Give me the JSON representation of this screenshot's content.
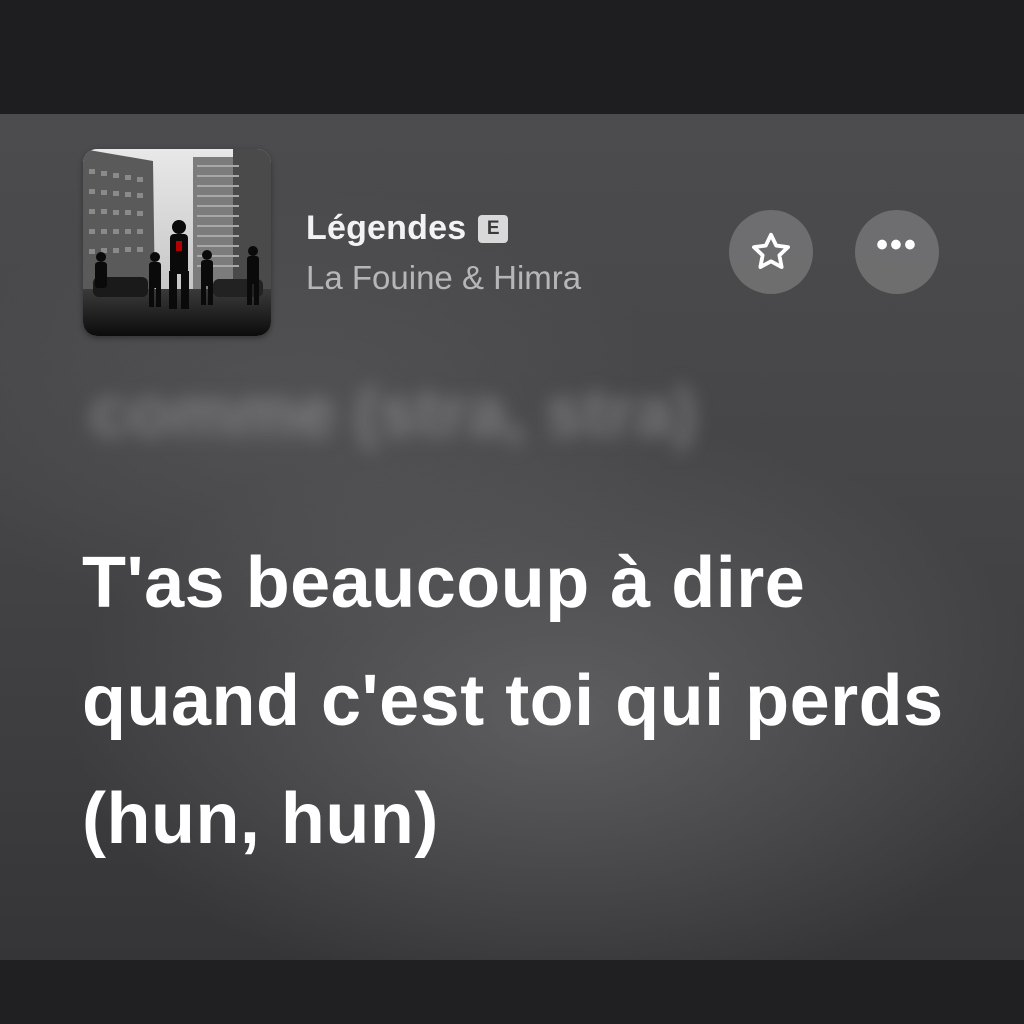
{
  "now_playing": {
    "title": "Légendes",
    "explicit_badge": "E",
    "artist": "La Fouine & Himra"
  },
  "controls": {
    "favorite_icon": "star-icon",
    "more_icon": "ellipsis-icon",
    "more_label": "•••"
  },
  "lyrics": {
    "previous_line": "comme (stra, stra)",
    "current_line": "T'as beaucoup à dire quand c'est toi qui perds (hun, hun)"
  },
  "colors": {
    "background": "#1f1f21",
    "panel": "#464648",
    "lyric_text": "#ffffff",
    "artist_text": "#b6b6b8"
  }
}
